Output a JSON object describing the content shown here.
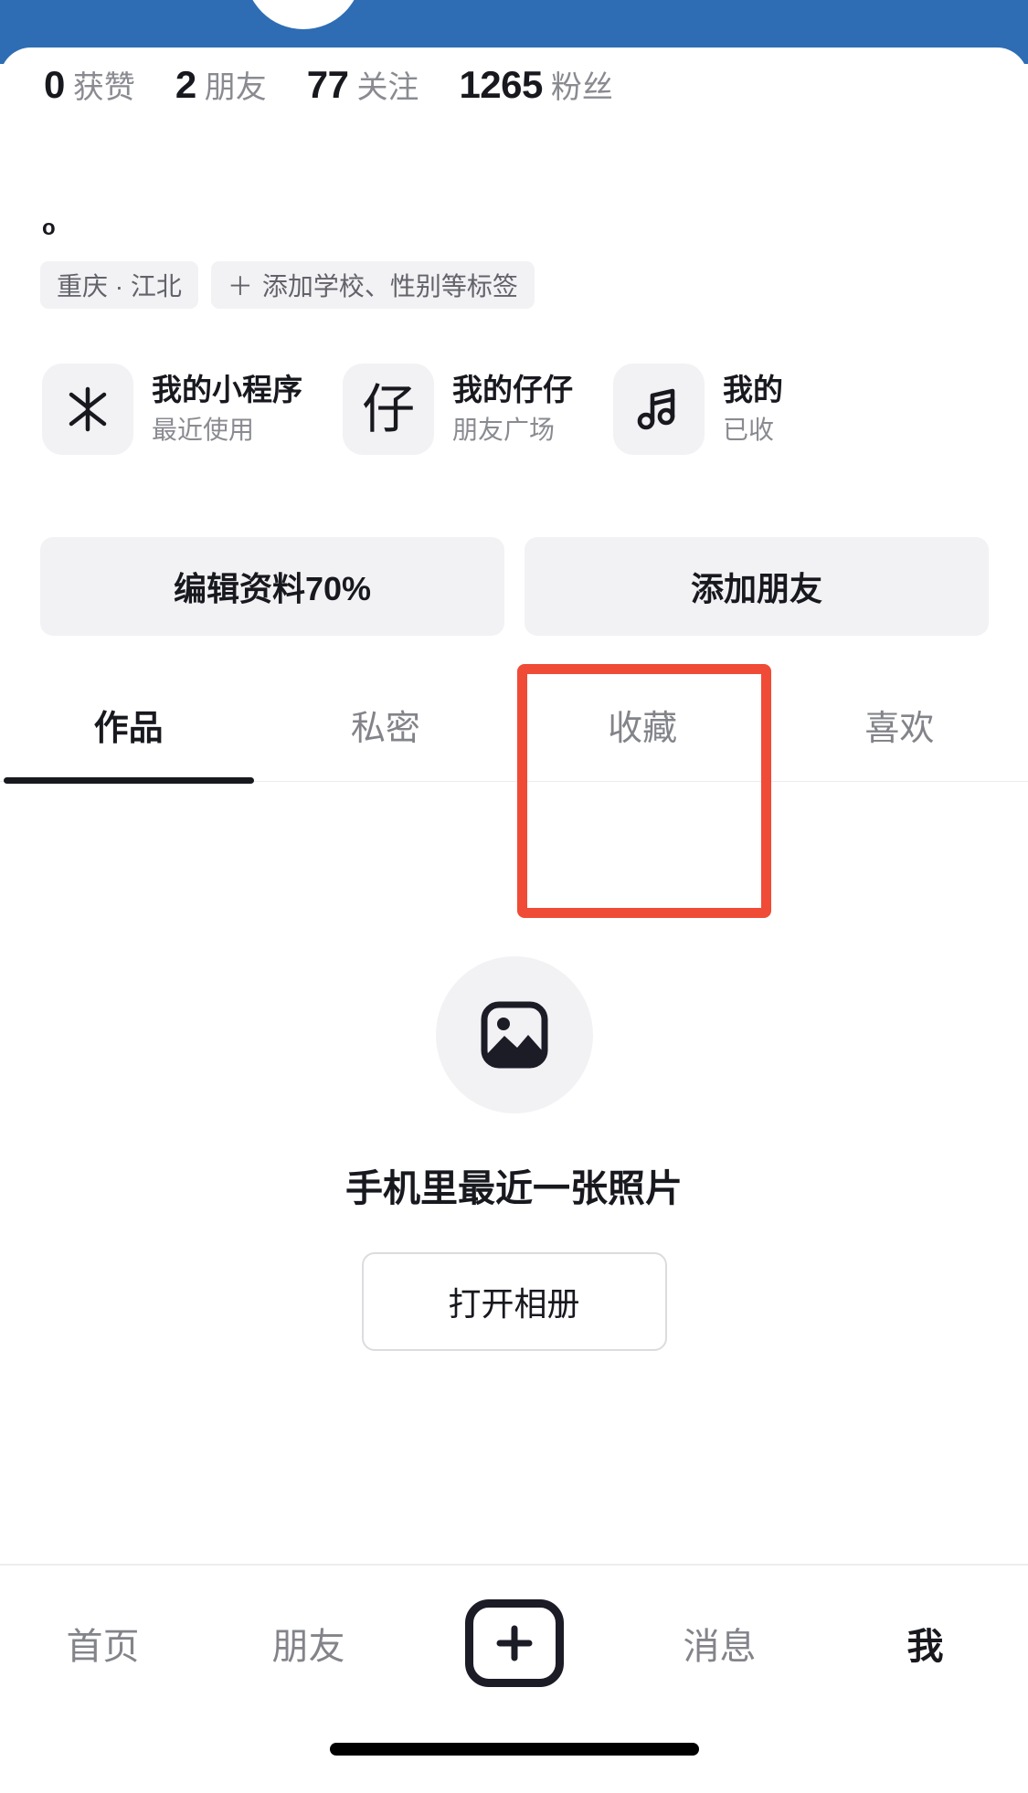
{
  "theme": {
    "header_blue": "#2E6DB4",
    "annotation_red": "#EF4B37",
    "text_primary": "#18191F",
    "text_secondary": "#8A8B91",
    "chip_bg": "#F2F2F4"
  },
  "profile": {
    "stats": [
      {
        "value": "0",
        "label": "获赞"
      },
      {
        "value": "2",
        "label": "朋友"
      },
      {
        "value": "77",
        "label": "关注"
      },
      {
        "value": "1265",
        "label": "粉丝"
      }
    ],
    "bio_fragment": "o",
    "tags": [
      {
        "icon": "",
        "label": "重庆 · 江北"
      },
      {
        "icon": "＋",
        "label": "添加学校、性别等标签"
      }
    ]
  },
  "mini_cards": [
    {
      "icon_name": "sparkle-icon",
      "title": "我的小程序",
      "subtitle": "最近使用"
    },
    {
      "icon_name": "zaizai-icon",
      "title": "我的仔仔",
      "subtitle": "朋友广场"
    },
    {
      "icon_name": "music-note-icon",
      "title": "我的",
      "subtitle": "已收"
    }
  ],
  "actions": [
    {
      "label": "编辑资料70%"
    },
    {
      "label": "添加朋友"
    }
  ],
  "tabs": [
    {
      "label": "作品",
      "active": true
    },
    {
      "label": "私密",
      "active": false
    },
    {
      "label": "收藏",
      "active": false
    },
    {
      "label": "喜欢",
      "active": false
    }
  ],
  "annotation": {
    "target_tab": "收藏",
    "color": "#EF4B37"
  },
  "empty_state": {
    "icon_name": "image-placeholder-icon",
    "title": "手机里最近一张照片",
    "button_label": "打开相册"
  },
  "bottom_nav": [
    {
      "label": "首页",
      "active": false,
      "type": "text"
    },
    {
      "label": "朋友",
      "active": false,
      "type": "text"
    },
    {
      "label": "＋",
      "active": false,
      "type": "plus"
    },
    {
      "label": "消息",
      "active": false,
      "type": "text"
    },
    {
      "label": "我",
      "active": true,
      "type": "text"
    }
  ]
}
